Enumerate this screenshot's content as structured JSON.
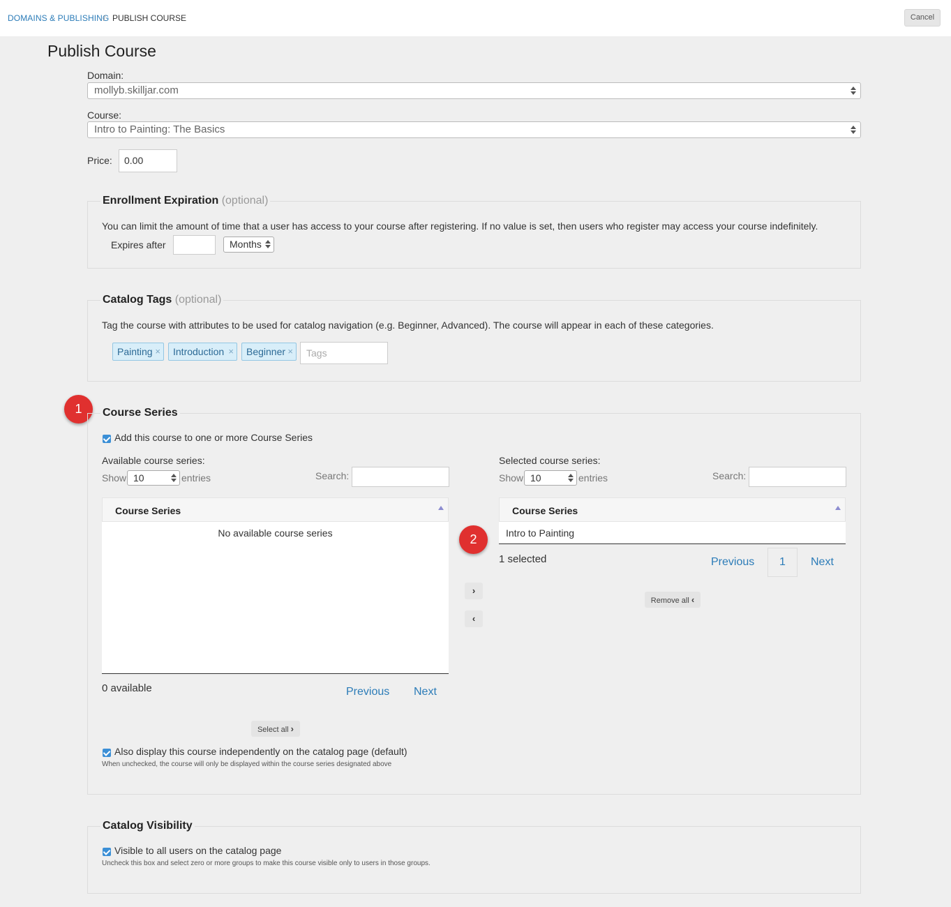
{
  "breadcrumb": {
    "parent": "DOMAINS & PUBLISHING",
    "separator": "/",
    "current": "PUBLISH COURSE"
  },
  "header": {
    "cancel_label": "Cancel"
  },
  "page": {
    "title": "Publish Course"
  },
  "form": {
    "domain_label": "Domain:",
    "domain_value": "mollyb.skilljar.com",
    "course_label": "Course:",
    "course_value": "Intro to Painting: The Basics",
    "price_label": "Price:",
    "price_value": "0.00"
  },
  "enrollment": {
    "title": "Enrollment Expiration",
    "optional": "(optional)",
    "description": "You can limit the amount of time that a user has access to your course after registering. If no value is set, then users who register may access your course indefinitely.",
    "expires_label": "Expires after",
    "expires_value": "",
    "unit_value": "Months"
  },
  "catalog_tags": {
    "title": "Catalog Tags",
    "optional": "(optional)",
    "description": "Tag the course with attributes to be used for catalog navigation (e.g. Beginner, Advanced). The course will appear in each of these categories.",
    "tags": [
      "Painting",
      "Introduction",
      "Beginner"
    ],
    "remove_glyph": "×",
    "tags_placeholder": "Tags"
  },
  "course_series": {
    "badge_1": "1",
    "badge_2": "2",
    "title": "Course Series",
    "add_checkbox_label": "Add this course to one or more Course Series",
    "available": {
      "label": "Available course series:",
      "show": "Show",
      "entries_value": "10",
      "entries": "entries",
      "search_label": "Search:",
      "column": "Course Series",
      "empty": "No available course series",
      "count": "0 available",
      "previous": "Previous",
      "next": "Next",
      "select_all": "Select all"
    },
    "move_right": "›",
    "move_left": "‹",
    "selected": {
      "label": "Selected course series:",
      "show": "Show",
      "entries_value": "10",
      "entries": "entries",
      "search_label": "Search:",
      "column": "Course Series",
      "rows": [
        "Intro to Painting"
      ],
      "count": "1 selected",
      "previous": "Previous",
      "page": "1",
      "next": "Next",
      "remove_all": "Remove all"
    },
    "display_checkbox_label": "Also display this course independently on the catalog page (default)",
    "display_note": "When unchecked, the course will only be displayed within the course series designated above"
  },
  "catalog_visibility": {
    "title": "Catalog Visibility",
    "checkbox_label": "Visible to all users on the catalog page",
    "note": "Uncheck this box and select zero or more groups to make this course visible only to users in those groups."
  },
  "colors": {
    "link": "#2c7cb8",
    "badge": "#e0302f",
    "checkbox": "#3b8fd6",
    "tag_bg": "#d8eef9"
  }
}
